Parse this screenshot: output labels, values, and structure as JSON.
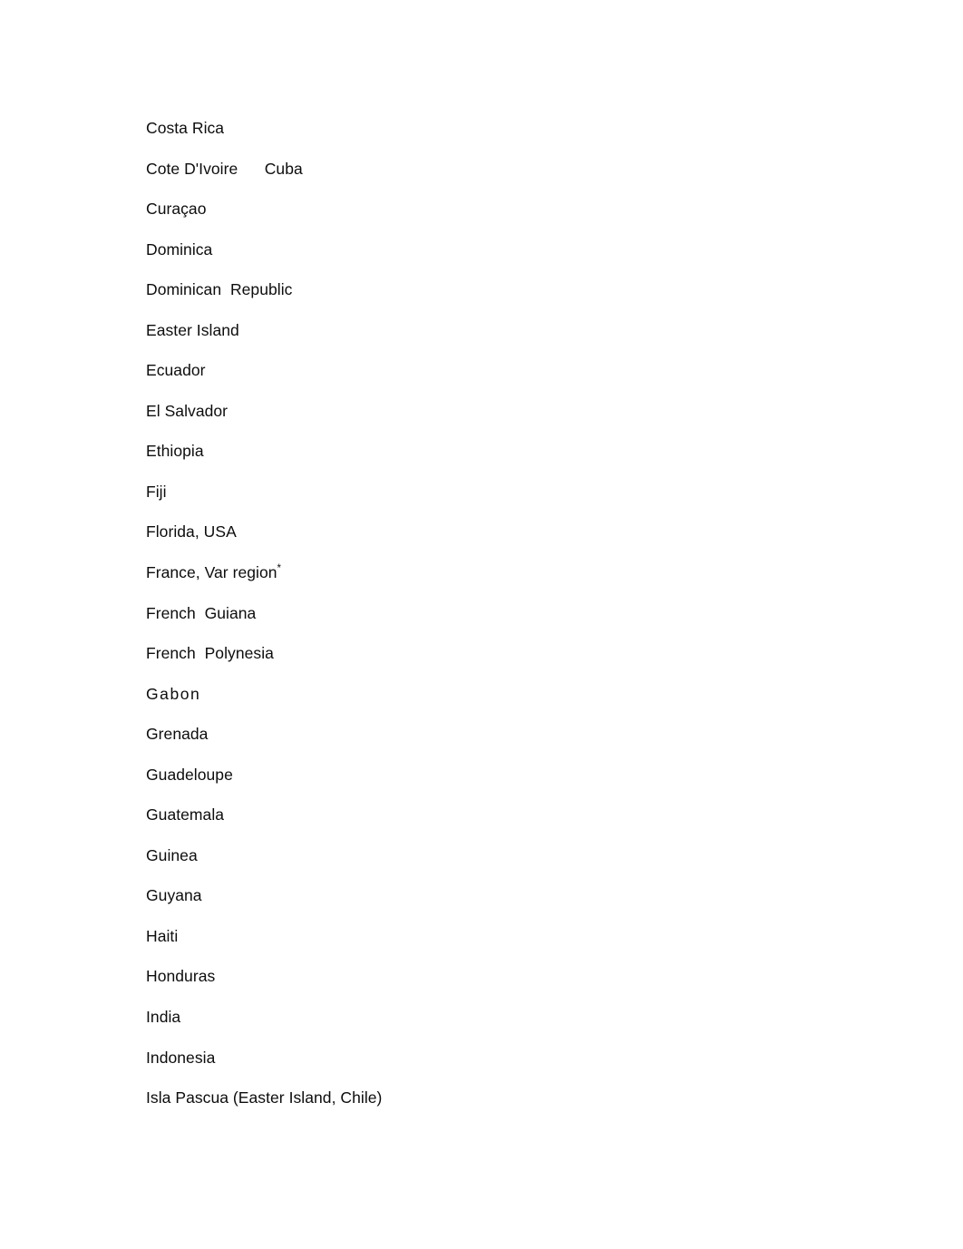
{
  "document": {
    "background_color": "#ffffff",
    "text_color": "#0d0d0d",
    "entries": [
      {
        "text": "Costa Rica",
        "style": "normal"
      },
      {
        "text": "Cote D'Ivoire      Cuba",
        "style": "tab"
      },
      {
        "text": "Curaçao",
        "style": "normal"
      },
      {
        "text": "Dominica",
        "style": "normal"
      },
      {
        "text": "Dominican  Republic",
        "style": "normal"
      },
      {
        "text": "Easter Island",
        "style": "normal"
      },
      {
        "text": "Ecuador",
        "style": "normal"
      },
      {
        "text": "El Salvador",
        "style": "normal"
      },
      {
        "text": "Ethiopia",
        "style": "normal"
      },
      {
        "text": "Fiji",
        "style": "normal"
      },
      {
        "text": "Florida, USA",
        "style": "normal"
      },
      {
        "text": "France, Var region",
        "style": "footnote",
        "footnote_marker": "*"
      },
      {
        "text": "French  Guiana",
        "style": "normal"
      },
      {
        "text": "French  Polynesia",
        "style": "normal"
      },
      {
        "text": "Gabon",
        "style": "tracked"
      },
      {
        "text": "Grenada",
        "style": "normal"
      },
      {
        "text": "Guadeloupe",
        "style": "normal"
      },
      {
        "text": "Guatemala",
        "style": "normal"
      },
      {
        "text": "Guinea",
        "style": "normal"
      },
      {
        "text": "Guyana",
        "style": "normal"
      },
      {
        "text": "Haiti",
        "style": "normal"
      },
      {
        "text": "Honduras",
        "style": "normal"
      },
      {
        "text": "India",
        "style": "normal"
      },
      {
        "text": "Indonesia",
        "style": "normal"
      },
      {
        "text": "Isla Pascua (Easter Island, Chile)",
        "style": "normal"
      }
    ]
  }
}
